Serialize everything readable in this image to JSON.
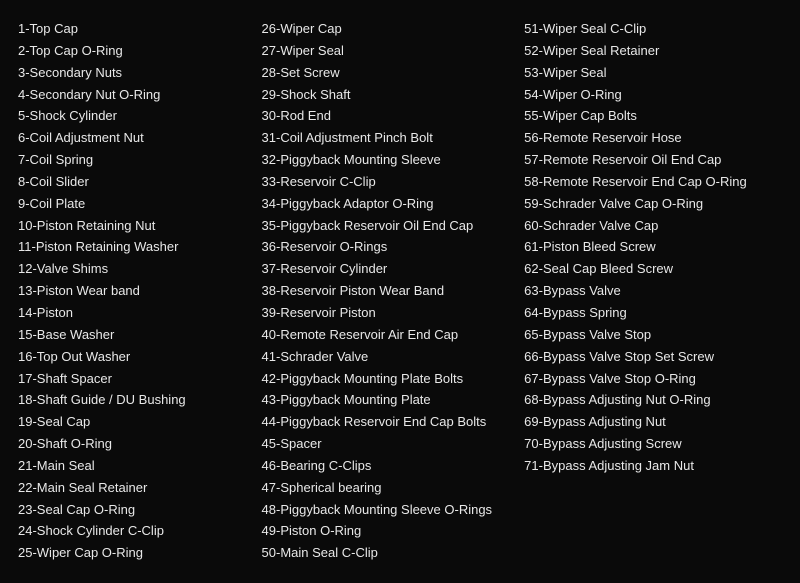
{
  "col1": {
    "items": [
      "1-Top Cap",
      "2-Top Cap O-Ring",
      "3-Secondary Nuts",
      "4-Secondary Nut O-Ring",
      "5-Shock Cylinder",
      "6-Coil Adjustment Nut",
      "7-Coil Spring",
      "8-Coil Slider",
      "9-Coil Plate",
      "10-Piston Retaining Nut",
      "11-Piston Retaining Washer",
      "12-Valve Shims",
      "13-Piston Wear band",
      "14-Piston",
      "15-Base Washer",
      "16-Top Out Washer",
      "17-Shaft Spacer",
      "18-Shaft Guide / DU Bushing",
      "19-Seal Cap",
      "20-Shaft O-Ring",
      "21-Main Seal",
      "22-Main Seal Retainer",
      "23-Seal Cap O-Ring",
      "24-Shock Cylinder C-Clip",
      "25-Wiper Cap O-Ring"
    ]
  },
  "col2": {
    "items": [
      "26-Wiper Cap",
      "27-Wiper Seal",
      "28-Set Screw",
      "29-Shock Shaft",
      "30-Rod End",
      "31-Coil Adjustment Pinch Bolt",
      "32-Piggyback Mounting Sleeve",
      "33-Reservoir C-Clip",
      "34-Piggyback Adaptor O-Ring",
      "35-Piggyback Reservoir Oil End Cap",
      "36-Reservoir O-Rings",
      "37-Reservoir Cylinder",
      "38-Reservoir Piston Wear Band",
      "39-Reservoir Piston",
      "40-Remote Reservoir Air End Cap",
      "41-Schrader Valve",
      "42-Piggyback Mounting Plate Bolts",
      "43-Piggyback Mounting Plate",
      "44-Piggyback Reservoir End Cap Bolts",
      "45-Spacer",
      "46-Bearing C-Clips",
      "47-Spherical bearing",
      "48-Piggyback Mounting Sleeve O-Rings",
      "49-Piston O-Ring",
      "50-Main Seal C-Clip"
    ]
  },
  "col3": {
    "items": [
      "51-Wiper Seal C-Clip",
      "52-Wiper Seal Retainer",
      "53-Wiper Seal",
      "54-Wiper O-Ring",
      "55-Wiper Cap Bolts",
      "56-Remote Reservoir Hose",
      "57-Remote Reservoir Oil End Cap",
      "58-Remote Reservoir End Cap O-Ring",
      "59-Schrader Valve Cap O-Ring",
      "60-Schrader Valve Cap",
      "61-Piston Bleed Screw",
      "62-Seal Cap Bleed Screw",
      "63-Bypass Valve",
      "64-Bypass Spring",
      "65-Bypass Valve Stop",
      "66-Bypass Valve Stop Set Screw",
      "67-Bypass Valve Stop O-Ring",
      "68-Bypass Adjusting Nut O-Ring",
      "69-Bypass Adjusting Nut",
      "70-Bypass Adjusting Screw",
      "71-Bypass Adjusting Jam Nut"
    ]
  }
}
